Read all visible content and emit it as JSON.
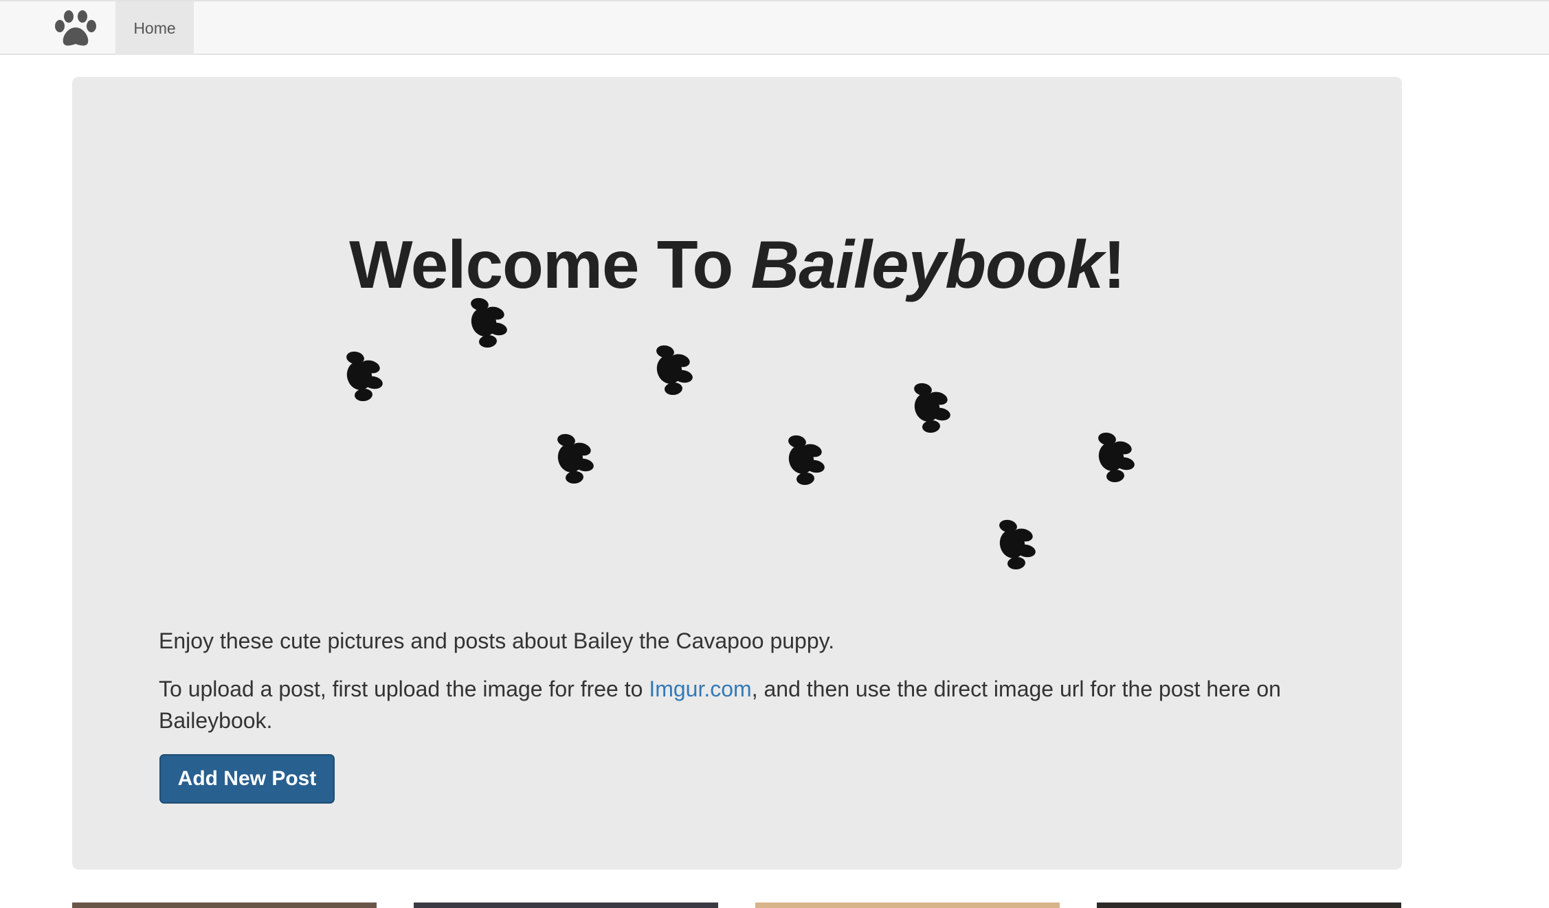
{
  "nav": {
    "brand_icon": "paw-icon",
    "home_label": "Home"
  },
  "hero": {
    "title_prefix": "Welcome To ",
    "title_brand": "Baileybook",
    "title_suffix": "!",
    "decoration_icon": "paw-print-icon",
    "intro_text": "Enjoy these cute pictures and posts about Bailey the Cavapoo puppy.",
    "upload_text_before": "To upload a post, first upload the image for free to ",
    "upload_link_text": "Imgur.com",
    "upload_text_after": ", and then use the direct image url for the post here on Baileybook.",
    "add_button_label": "Add New Post"
  },
  "colors": {
    "navbar_bg": "#f7f7f7",
    "jumbotron_bg": "#eaeaea",
    "link": "#337ab7",
    "primary_button": "#286090",
    "paw": "#111111"
  }
}
